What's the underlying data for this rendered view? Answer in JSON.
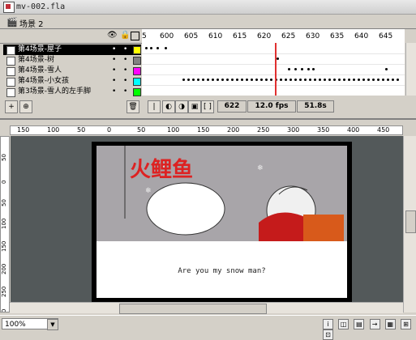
{
  "window": {
    "title": "mv-002.fla"
  },
  "scene": {
    "label": "场景 2"
  },
  "timeline": {
    "ruler": [
      "5",
      "600",
      "605",
      "610",
      "615",
      "620",
      "625",
      "630",
      "635",
      "640",
      "645"
    ],
    "layers": [
      {
        "name": "第4场景-屋子",
        "selected": true,
        "color": "#ffff00"
      },
      {
        "name": "第4场景-树",
        "selected": false,
        "color": "#808080"
      },
      {
        "name": "第4场景-雪人",
        "selected": false,
        "color": "#ff00ff"
      },
      {
        "name": "第4场景-小女孩",
        "selected": false,
        "color": "#00ffff"
      },
      {
        "name": "第3场景-雪人的左手脚",
        "selected": false,
        "color": "#00ff00"
      }
    ],
    "current_frame": "622",
    "fps": "12.0 fps",
    "elapsed": "51.8s"
  },
  "hruler": [
    "150",
    "100",
    "50",
    "0",
    "50",
    "100",
    "150",
    "200",
    "250",
    "300",
    "350",
    "400",
    "450"
  ],
  "vruler": [
    "50",
    "0",
    "50",
    "100",
    "150",
    "200",
    "250",
    "290"
  ],
  "stage": {
    "caption": "Are you my snow man?",
    "watermark": "火鲤鱼"
  },
  "status": {
    "zoom": "100%"
  }
}
